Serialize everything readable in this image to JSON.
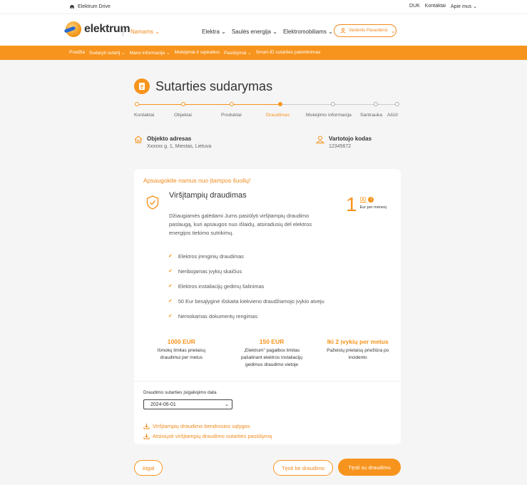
{
  "topbar": {
    "brand": "Elektrum Drive",
    "links": [
      "DUK",
      "Kontaktai",
      "Apie mus"
    ]
  },
  "header": {
    "logo_text": "elektrum",
    "segment": "Namams",
    "nav": [
      "Elektra",
      "Saulės energija",
      "Elektromobiliams"
    ],
    "user": "Vardenis Pavardenis"
  },
  "orange_nav": [
    "Pradžia",
    "Sudaryti sutartį",
    "Mano informacija",
    "Mokėjimai ir sąskaitos",
    "Pasiūlymai",
    "Smart-ID sutarties patvirtinimas"
  ],
  "page": {
    "title": "Sutarties sudarymas"
  },
  "stepper": {
    "steps": [
      "Kontaktai",
      "Objektai",
      "Produktai",
      "Draudimas",
      "Mokėjimo informacija",
      "Santrauka",
      "Ačiū!"
    ],
    "active_index": 3
  },
  "info": {
    "address_label": "Objekto adresas",
    "address_value": "Xxxxxx g. 1, Miestas, Lietuva",
    "code_label": "Vartotojo kodas",
    "code_value": "12345672"
  },
  "card": {
    "subhead": "Apsaugokite namus nuo įtampos šuolių!",
    "title": "Viršįtampių draudimas",
    "description": "Džiaugiamės galėdami Jums pasiūlyti viršįtampių draudimo paslaugą, kuri apsaugos nuo išlaidų, atsiradusių dėl elektros energijos tiekimo sutrikimų.",
    "price_whole": "1",
    "price_cents": "00",
    "price_unit": "Eur per mėnesį",
    "features": [
      "Elektros įrenginių draudimas",
      "Neribojamas įvykių skaičius",
      "Elektros instaliacijų gedimų šalinimas",
      "50 Eur besąlyginė išskaita kiekvieno draudžiamojo įvykio atveju",
      "Nemokamas dokumentų rengimas"
    ],
    "stats": [
      {
        "value": "1000 EUR",
        "desc": "Išmokų limitas prietaisų draudimui per metus"
      },
      {
        "value": "150 EUR",
        "desc": "„Elektrum\" pagalbos limitas pašalinant elektros instaliacijų gedimus draudimo vietoje"
      },
      {
        "value": "Iki 2 įvykių per metus",
        "desc": "Pažeistų prietaisų priežiūra po incidento"
      }
    ],
    "date_label": "Draudimo sutarties įsigaliojimo data",
    "date_value": "2024-06-01",
    "links": [
      "Viršįtampių draudimo bendrosios sąlygos",
      "Atsisiųsti viršįtampių draudimo sutarties pasiūlymą"
    ]
  },
  "buttons": {
    "back": "Atgal",
    "skip": "Tęsti be draudimo",
    "continue": "Tęsti su draudimu"
  },
  "colors": {
    "accent": "#f7941d"
  }
}
